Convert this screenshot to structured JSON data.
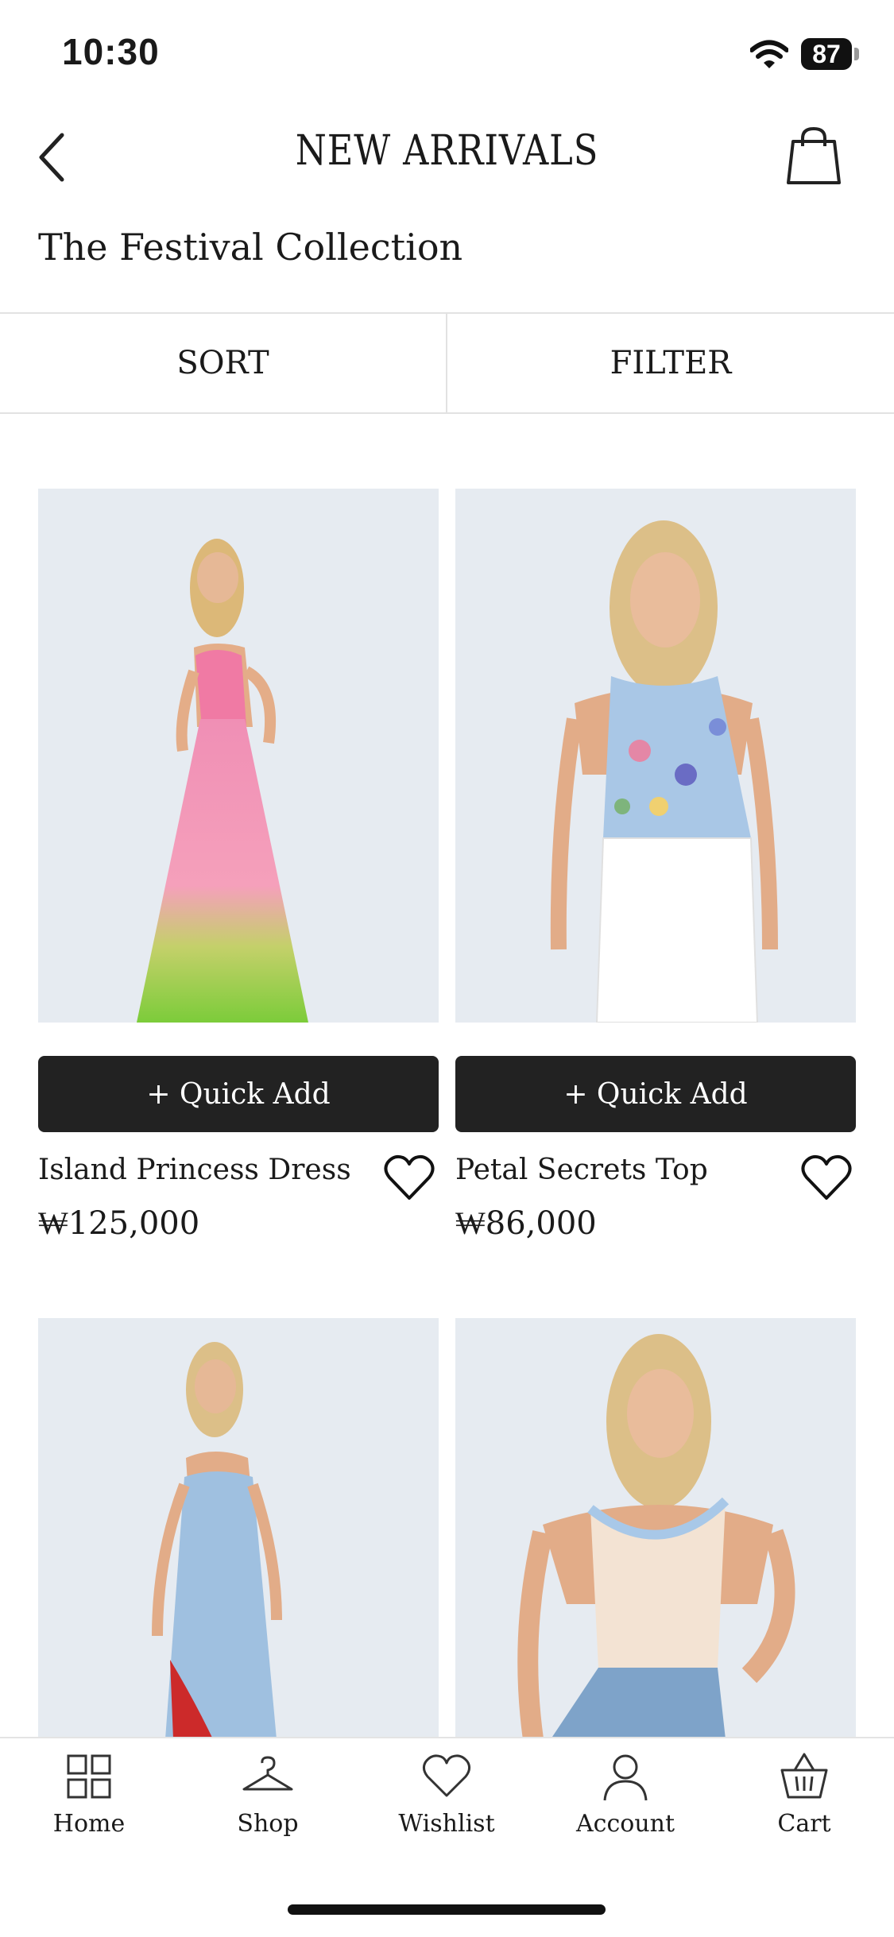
{
  "status": {
    "time": "10:30",
    "battery": "87"
  },
  "header": {
    "title": "NEW ARRIVALS",
    "subtitle": "The Festival Collection"
  },
  "controls": {
    "sort_label": "SORT",
    "filter_label": "FILTER"
  },
  "products": [
    {
      "name": "Island Princess Dress",
      "price": "₩125,000",
      "button": "+ Quick Add"
    },
    {
      "name": "Petal Secrets Top",
      "price": "₩86,000",
      "button": "+ Quick Add"
    },
    {
      "name": "",
      "price": "",
      "button": ""
    },
    {
      "name": "",
      "price": "",
      "button": ""
    }
  ],
  "tabbar": {
    "items": [
      {
        "label": "Home",
        "icon": "grid-icon"
      },
      {
        "label": "Shop",
        "icon": "hanger-icon"
      },
      {
        "label": "Wishlist",
        "icon": "heart-icon"
      },
      {
        "label": "Account",
        "icon": "person-icon"
      },
      {
        "label": "Cart",
        "icon": "basket-icon"
      }
    ]
  }
}
